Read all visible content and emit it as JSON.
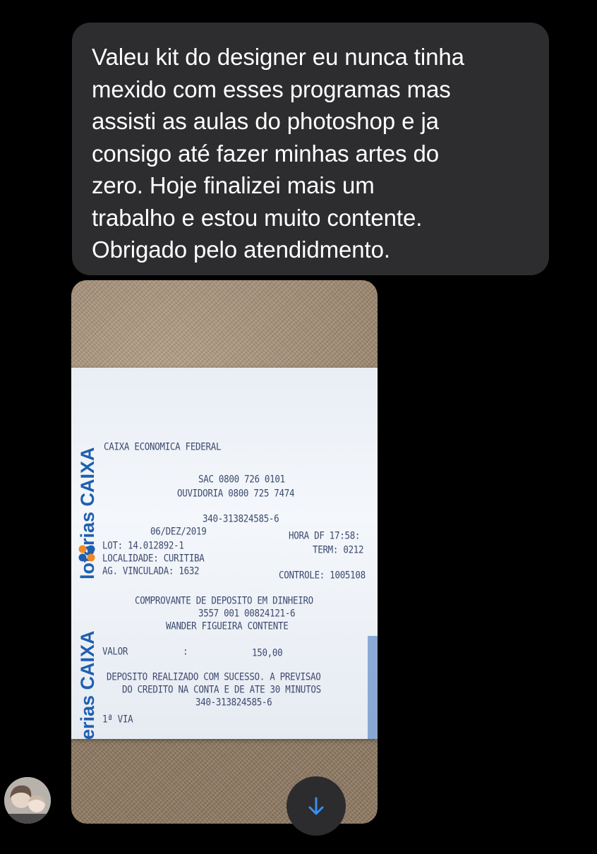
{
  "message": {
    "lines": [
      "Valeu kit do designer eu nunca tinha",
      "mexido com esses programas mas",
      "assisti as aulas do photoshop e ja",
      "consigo até fazer minhas artes do",
      "zero. Hoje finalizei mais um",
      "trabalho e estou muito contente.",
      "Obrigado pelo atendidmento."
    ]
  },
  "receipt": {
    "side_brand_top": "loterias CAIXA",
    "side_brand_bottom": "loterias CAIXA",
    "bank_name": "CAIXA ECONOMICA FEDERAL",
    "sac": "SAC 0800 726 0101",
    "ouvidoria": "OUVIDORIA 0800 725 7474",
    "transaction_id": "340-313824585-6",
    "date": "06/DEZ/2019",
    "time": "HORA DF 17:58:",
    "lot": "LOT: 14.012892-1",
    "term": "TERM: 0212",
    "localidade": "LOCALIDADE: CURITIBA",
    "agencia": "AG. VINCULADA: 1632",
    "controle": "CONTROLE: 1005108",
    "title": "COMPROVANTE DE DEPOSITO EM DINHEIRO",
    "account": "3557 001 00824121-6",
    "holder": "WANDER FIGUEIRA CONTENTE",
    "valor_label": "VALOR",
    "valor_sep": ":",
    "valor_amount": "150,00",
    "notice_line1": "DEPOSITO REALIZADO COM SUCESSO. A PREVISAO",
    "notice_line2": "DO CREDITO NA CONTA E DE ATE 30 MINUTOS",
    "notice_line3": "340-313824585-6",
    "via": "1ª VIA"
  },
  "icons": {
    "scroll_down": "arrow-down-icon",
    "avatar": "user-avatar"
  },
  "colors": {
    "background": "#000000",
    "bubble": "#2d2d2f",
    "bubble_text": "#ffffff",
    "scroll_arrow": "#3b8ef0",
    "caixa_blue": "#1f5fb0",
    "caixa_orange": "#f08a24"
  }
}
